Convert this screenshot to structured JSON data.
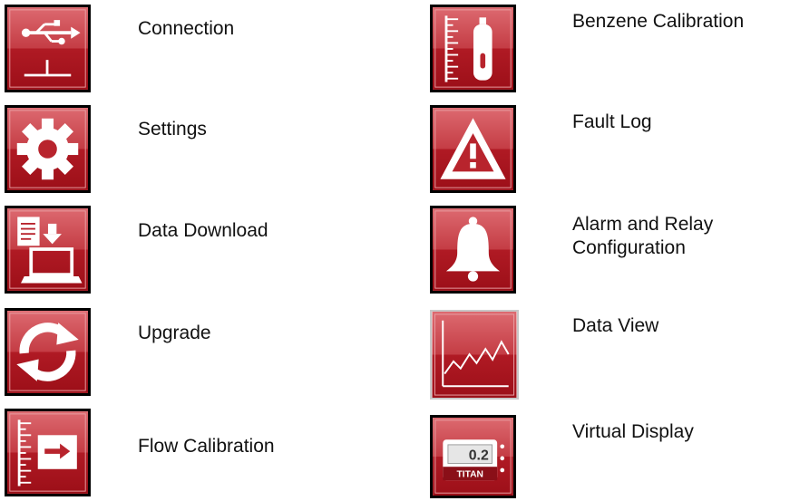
{
  "menu": {
    "left": [
      {
        "id": "connection",
        "label": "Connection",
        "icon": "usb-icon"
      },
      {
        "id": "settings",
        "label": "Settings",
        "icon": "gear-icon"
      },
      {
        "id": "data-download",
        "label": "Data Download",
        "icon": "download-to-computer-icon"
      },
      {
        "id": "upgrade",
        "label": "Upgrade",
        "icon": "refresh-arrows-icon"
      },
      {
        "id": "flow-calibration",
        "label": "Flow Calibration",
        "icon": "scale-arrow-icon"
      }
    ],
    "right": [
      {
        "id": "benzene-calibration",
        "label": "Benzene Calibration",
        "icon": "gas-cylinder-scale-icon"
      },
      {
        "id": "fault-log",
        "label": "Fault Log",
        "icon": "warning-triangle-icon"
      },
      {
        "id": "alarm-relay",
        "label_line1": "Alarm and Relay",
        "label_line2": "Configuration",
        "icon": "bell-icon"
      },
      {
        "id": "data-view",
        "label": "Data View",
        "icon": "line-graph-icon"
      },
      {
        "id": "virtual-display",
        "label": "Virtual Display",
        "icon": "device-display-icon",
        "display_value": "0.2",
        "display_brand": "TITAN"
      }
    ]
  },
  "colors": {
    "tile_top": "#d0545a",
    "tile_bottom": "#a8121c",
    "icon": "#ffffff"
  }
}
